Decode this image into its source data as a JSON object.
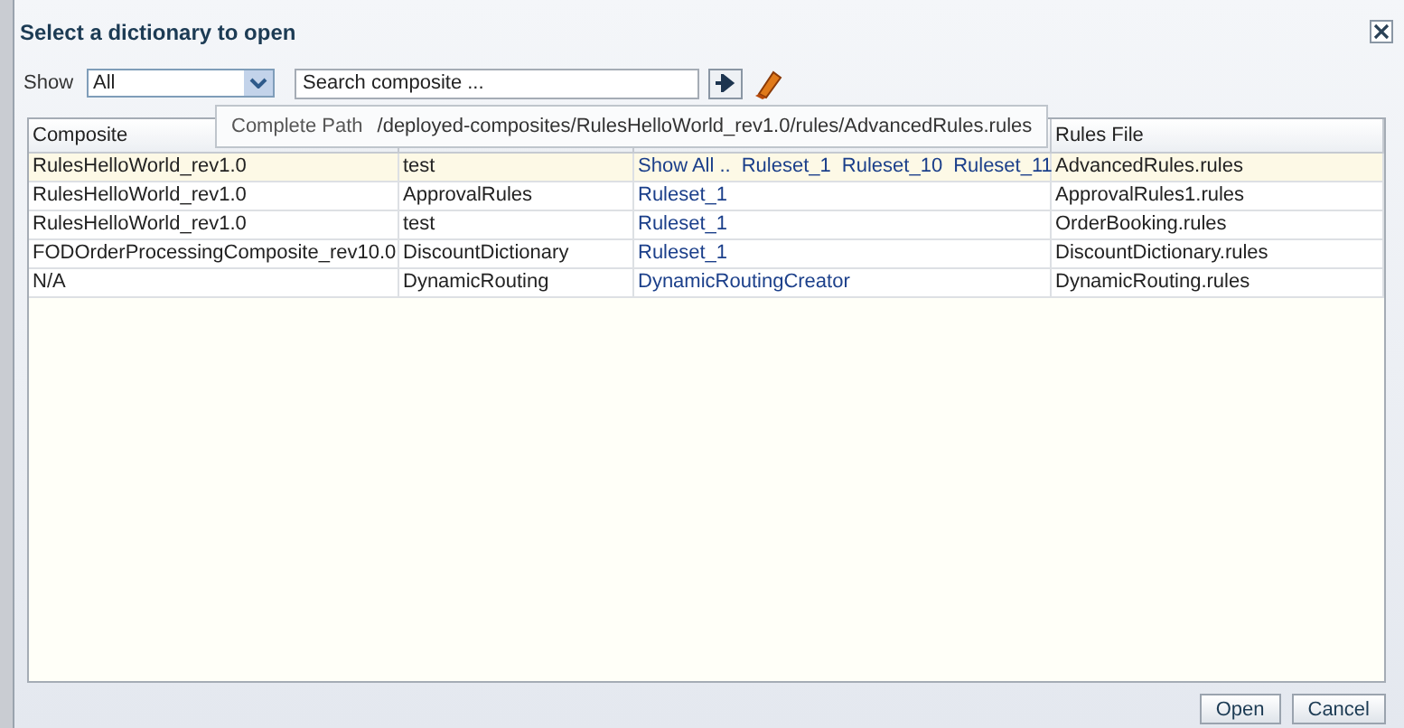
{
  "dialog": {
    "title": "Select a dictionary to open"
  },
  "filter": {
    "label": "Show",
    "value": "All",
    "search_placeholder": "Search composite ..."
  },
  "tooltip": {
    "label": "Complete Path",
    "value": "/deployed-composites/RulesHelloWorld_rev1.0/rules/AdvancedRules.rules"
  },
  "table": {
    "columns": [
      "Composite",
      "Rules File"
    ],
    "rows": [
      {
        "composite": "RulesHelloWorld_rev1.0",
        "dictionary": "test",
        "links": [
          "Show All ..",
          "Ruleset_1",
          "Ruleset_10",
          "Ruleset_11"
        ],
        "rules_file": "AdvancedRules.rules",
        "selected": true
      },
      {
        "composite": "RulesHelloWorld_rev1.0",
        "dictionary": "ApprovalRules",
        "links": [
          "Ruleset_1"
        ],
        "rules_file": "ApprovalRules1.rules",
        "selected": false
      },
      {
        "composite": "RulesHelloWorld_rev1.0",
        "dictionary": "test",
        "links": [
          "Ruleset_1"
        ],
        "rules_file": "OrderBooking.rules",
        "selected": false
      },
      {
        "composite": "FODOrderProcessingComposite_rev10.0",
        "dictionary": "DiscountDictionary",
        "links": [
          "Ruleset_1"
        ],
        "rules_file": "DiscountDictionary.rules",
        "selected": false
      },
      {
        "composite": "N/A",
        "dictionary": "DynamicRouting",
        "links": [
          "DynamicRoutingCreator"
        ],
        "rules_file": "DynamicRouting.rules",
        "selected": false
      }
    ]
  },
  "buttons": [
    "Open",
    "Cancel"
  ]
}
